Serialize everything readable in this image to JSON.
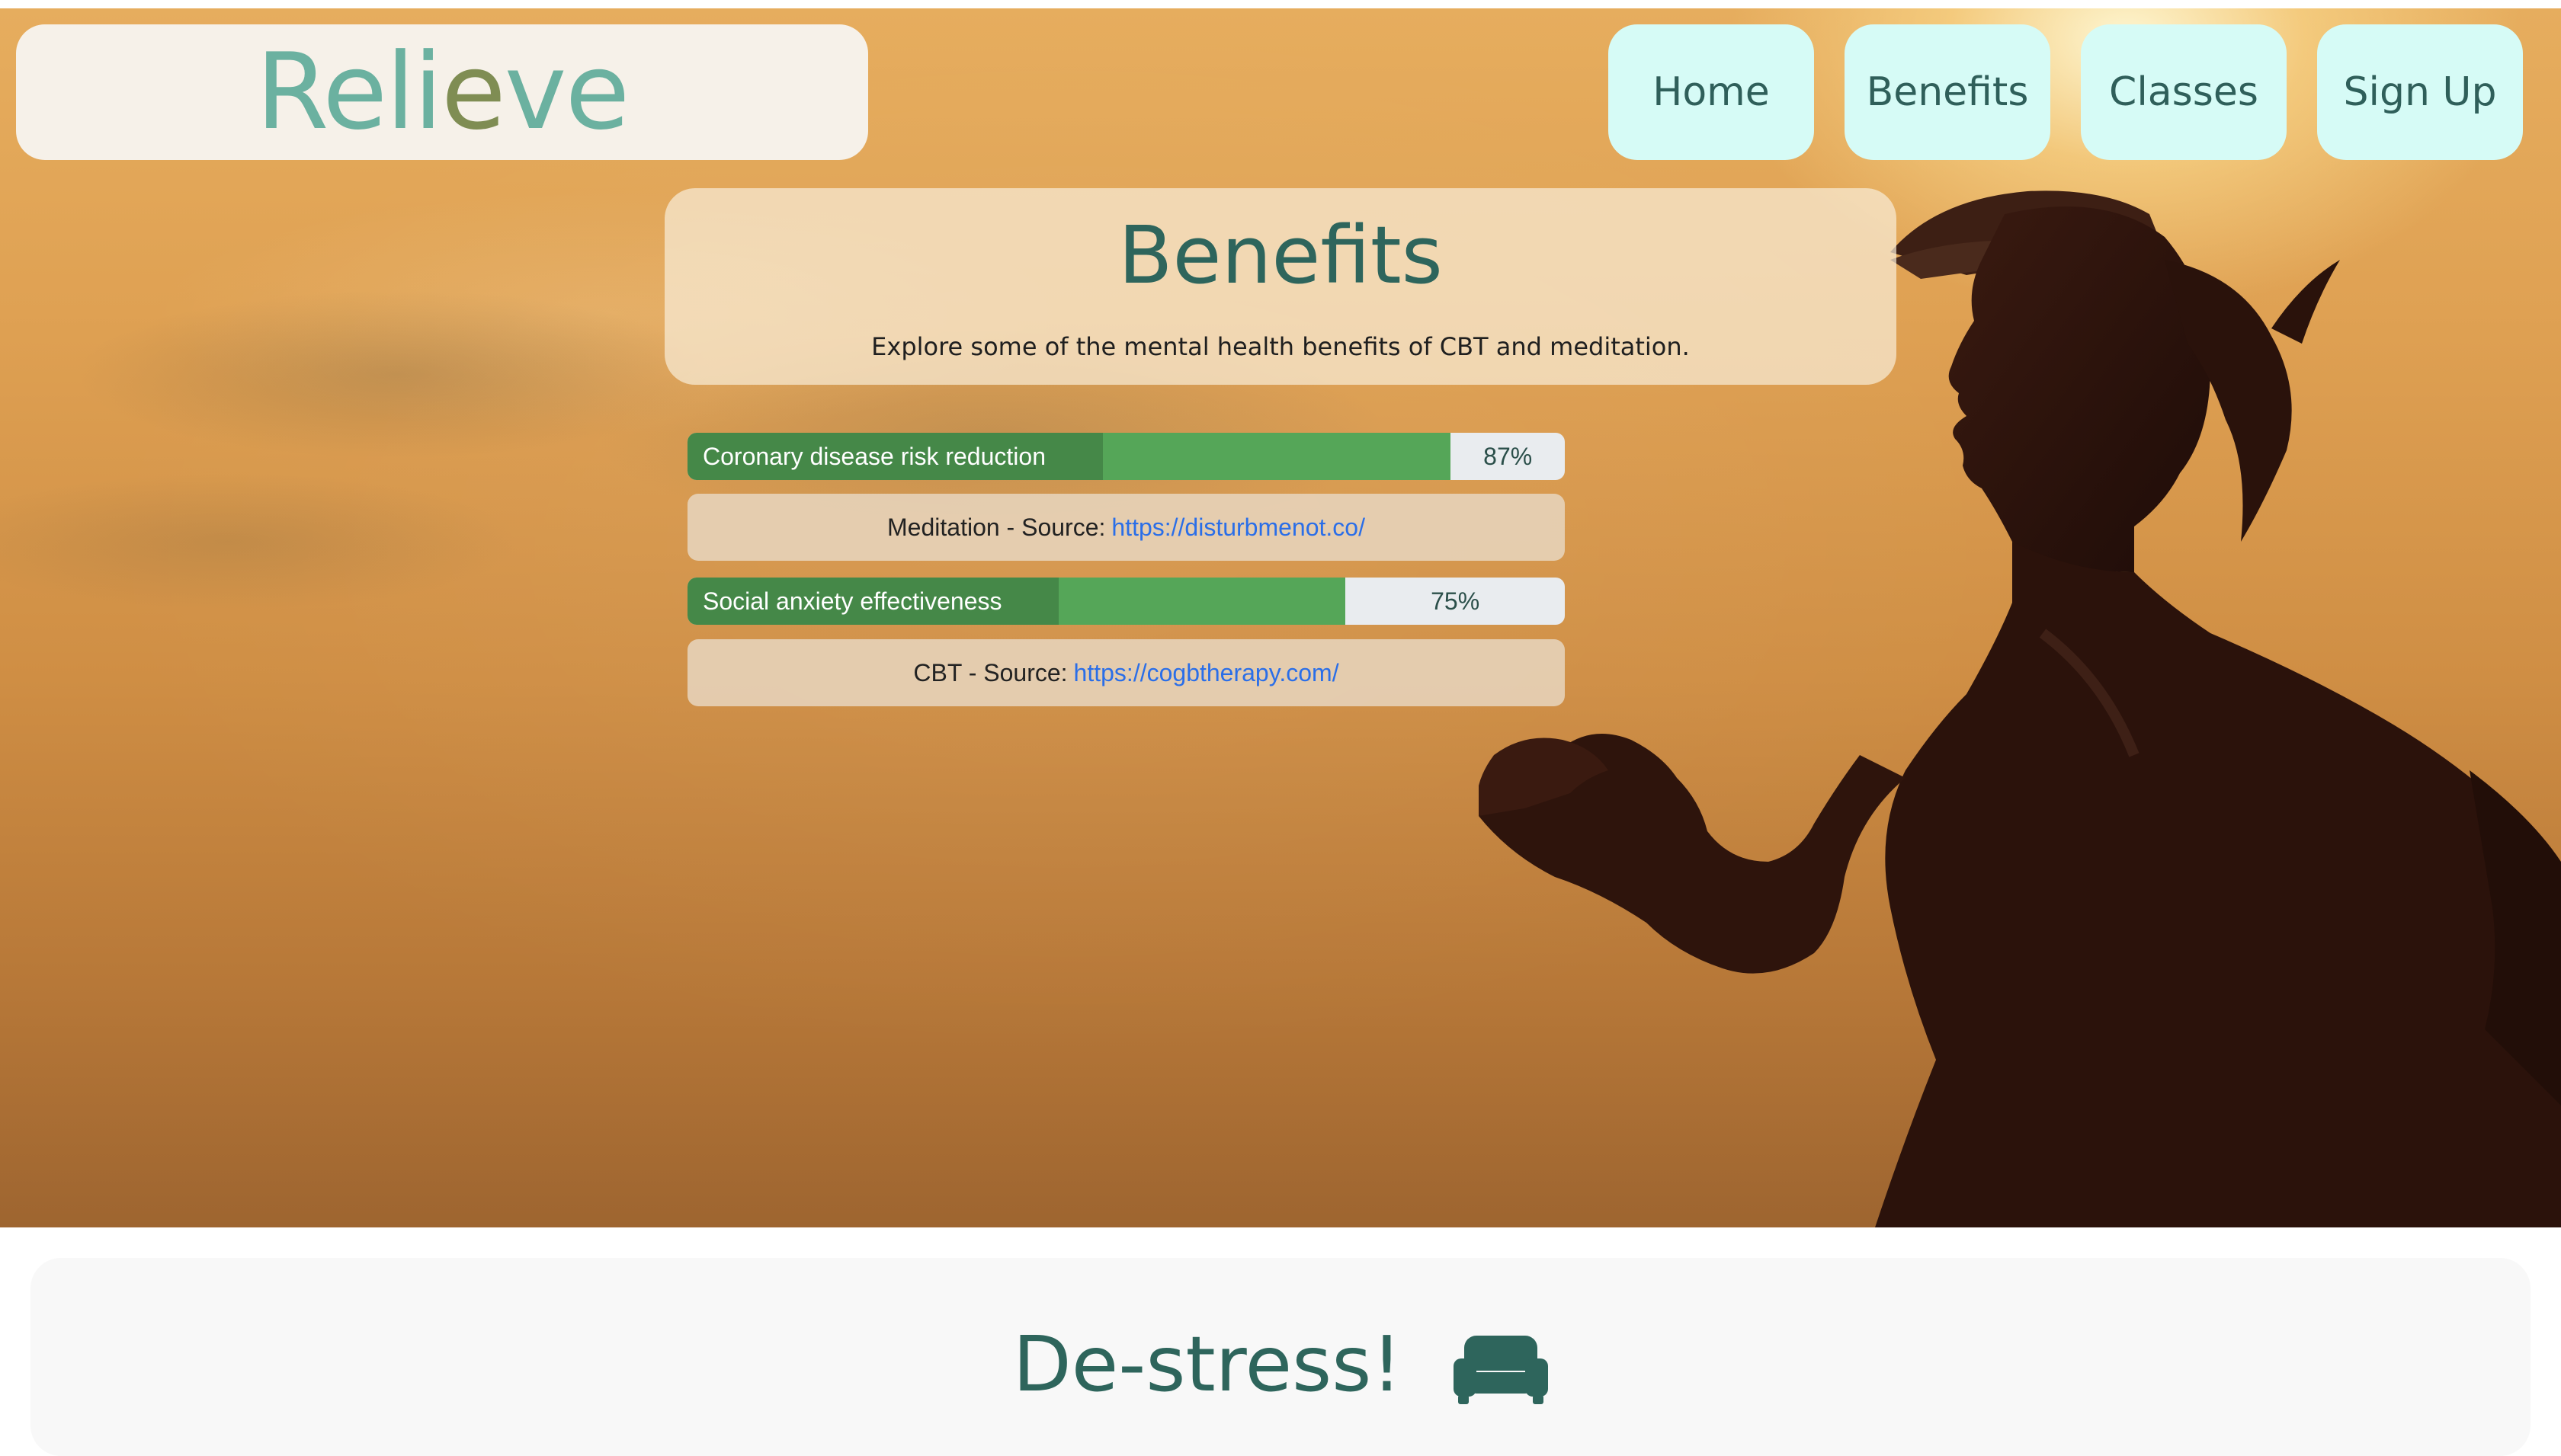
{
  "brand": {
    "logo_prefix": "Reli",
    "logo_accent": "e",
    "logo_suffix": "ve"
  },
  "nav": {
    "home": "Home",
    "benefits": "Benefits",
    "classes": "Classes",
    "signup": "Sign Up"
  },
  "benefits": {
    "title": "Benefits",
    "subtitle": "Explore some of the mental health benefits of CBT and meditation.",
    "items": [
      {
        "label": "Coronary disease risk reduction",
        "percent_text": "87%",
        "fraction": 0.87,
        "source_prefix": "Meditation - Source:",
        "source_link": "https://disturbmenot.co/"
      },
      {
        "label": "Social anxiety effectiveness",
        "percent_text": "75%",
        "fraction": 0.75,
        "source_prefix": "CBT - Source:",
        "source_link": "https://cogbtherapy.com/"
      }
    ]
  },
  "destress": {
    "title": "De-stress!",
    "icon": "couch-icon"
  },
  "colors": {
    "teal_dark": "#2e655c",
    "teal_logo": "#6bb1a0",
    "nav_bg": "#d6fbf6",
    "progress_green": "#55a658",
    "link_blue": "#2a6ee8"
  }
}
